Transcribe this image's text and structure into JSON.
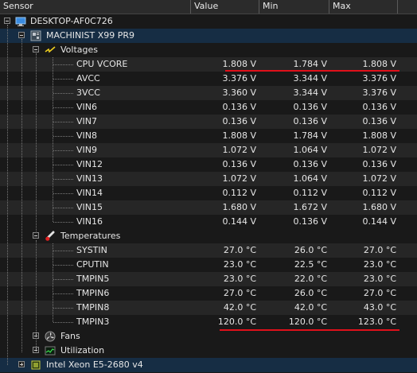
{
  "columns": {
    "sensor": "Sensor",
    "value": "Value",
    "min": "Min",
    "max": "Max"
  },
  "tree": {
    "computer": "DESKTOP-AF0C726",
    "motherboard": "MACHINIST X99 PR9",
    "voltages_group": "Voltages",
    "voltages": [
      {
        "name": "CPU VCORE",
        "value": "1.808 V",
        "min": "1.784 V",
        "max": "1.808 V"
      },
      {
        "name": "AVCC",
        "value": "3.376 V",
        "min": "3.344 V",
        "max": "3.376 V"
      },
      {
        "name": "3VCC",
        "value": "3.360 V",
        "min": "3.344 V",
        "max": "3.376 V"
      },
      {
        "name": "VIN6",
        "value": "0.136 V",
        "min": "0.136 V",
        "max": "0.136 V"
      },
      {
        "name": "VIN7",
        "value": "0.136 V",
        "min": "0.136 V",
        "max": "0.136 V"
      },
      {
        "name": "VIN8",
        "value": "1.808 V",
        "min": "1.784 V",
        "max": "1.808 V"
      },
      {
        "name": "VIN9",
        "value": "1.072 V",
        "min": "1.064 V",
        "max": "1.072 V"
      },
      {
        "name": "VIN12",
        "value": "0.136 V",
        "min": "0.136 V",
        "max": "0.136 V"
      },
      {
        "name": "VIN13",
        "value": "1.072 V",
        "min": "1.064 V",
        "max": "1.072 V"
      },
      {
        "name": "VIN14",
        "value": "0.112 V",
        "min": "0.112 V",
        "max": "0.112 V"
      },
      {
        "name": "VIN15",
        "value": "1.680 V",
        "min": "1.672 V",
        "max": "1.680 V"
      },
      {
        "name": "VIN16",
        "value": "0.144 V",
        "min": "0.136 V",
        "max": "0.144 V"
      }
    ],
    "temperatures_group": "Temperatures",
    "temperatures": [
      {
        "name": "SYSTIN",
        "value": "27.0 °C",
        "min": "26.0 °C",
        "max": "27.0 °C"
      },
      {
        "name": "CPUTIN",
        "value": "23.0 °C",
        "min": "22.5 °C",
        "max": "23.0 °C"
      },
      {
        "name": "TMPIN5",
        "value": "23.0 °C",
        "min": "22.0 °C",
        "max": "23.0 °C"
      },
      {
        "name": "TMPIN6",
        "value": "27.0 °C",
        "min": "26.0 °C",
        "max": "27.0 °C"
      },
      {
        "name": "TMPIN8",
        "value": "42.0 °C",
        "min": "42.0 °C",
        "max": "43.0 °C"
      },
      {
        "name": "TMPIN3",
        "value": "120.0 °C",
        "min": "120.0 °C",
        "max": "123.0 °C"
      }
    ],
    "fans_group": "Fans",
    "utilization_group": "Utilization",
    "cpu": "Intel Xeon E5-2680 v4"
  },
  "annotation_color": "#e0101a"
}
